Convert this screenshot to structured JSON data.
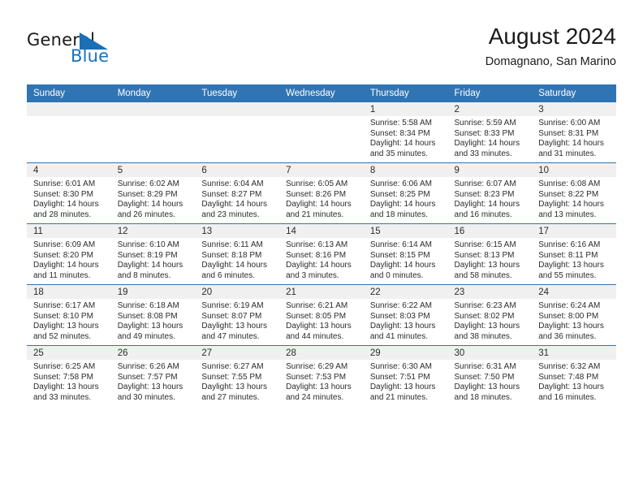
{
  "brand": {
    "name_part1": "General",
    "name_part2": "Blue",
    "accent_color": "#1673be",
    "header_color": "#3174b4"
  },
  "header": {
    "title": "August 2024",
    "location": "Domagnano, San Marino"
  },
  "calendar": {
    "weekday_headers": [
      "Sunday",
      "Monday",
      "Tuesday",
      "Wednesday",
      "Thursday",
      "Friday",
      "Saturday"
    ],
    "weeks": [
      [
        {
          "day": "",
          "blank": true,
          "sunrise": "",
          "sunset": "",
          "daylight_line1": "",
          "daylight_line2": ""
        },
        {
          "day": "",
          "blank": true,
          "sunrise": "",
          "sunset": "",
          "daylight_line1": "",
          "daylight_line2": ""
        },
        {
          "day": "",
          "blank": true,
          "sunrise": "",
          "sunset": "",
          "daylight_line1": "",
          "daylight_line2": ""
        },
        {
          "day": "",
          "blank": true,
          "sunrise": "",
          "sunset": "",
          "daylight_line1": "",
          "daylight_line2": ""
        },
        {
          "day": "1",
          "blank": false,
          "sunrise": "Sunrise: 5:58 AM",
          "sunset": "Sunset: 8:34 PM",
          "daylight_line1": "Daylight: 14 hours",
          "daylight_line2": "and 35 minutes."
        },
        {
          "day": "2",
          "blank": false,
          "sunrise": "Sunrise: 5:59 AM",
          "sunset": "Sunset: 8:33 PM",
          "daylight_line1": "Daylight: 14 hours",
          "daylight_line2": "and 33 minutes."
        },
        {
          "day": "3",
          "blank": false,
          "sunrise": "Sunrise: 6:00 AM",
          "sunset": "Sunset: 8:31 PM",
          "daylight_line1": "Daylight: 14 hours",
          "daylight_line2": "and 31 minutes."
        }
      ],
      [
        {
          "day": "4",
          "blank": false,
          "sunrise": "Sunrise: 6:01 AM",
          "sunset": "Sunset: 8:30 PM",
          "daylight_line1": "Daylight: 14 hours",
          "daylight_line2": "and 28 minutes."
        },
        {
          "day": "5",
          "blank": false,
          "sunrise": "Sunrise: 6:02 AM",
          "sunset": "Sunset: 8:29 PM",
          "daylight_line1": "Daylight: 14 hours",
          "daylight_line2": "and 26 minutes."
        },
        {
          "day": "6",
          "blank": false,
          "sunrise": "Sunrise: 6:04 AM",
          "sunset": "Sunset: 8:27 PM",
          "daylight_line1": "Daylight: 14 hours",
          "daylight_line2": "and 23 minutes."
        },
        {
          "day": "7",
          "blank": false,
          "sunrise": "Sunrise: 6:05 AM",
          "sunset": "Sunset: 8:26 PM",
          "daylight_line1": "Daylight: 14 hours",
          "daylight_line2": "and 21 minutes."
        },
        {
          "day": "8",
          "blank": false,
          "sunrise": "Sunrise: 6:06 AM",
          "sunset": "Sunset: 8:25 PM",
          "daylight_line1": "Daylight: 14 hours",
          "daylight_line2": "and 18 minutes."
        },
        {
          "day": "9",
          "blank": false,
          "sunrise": "Sunrise: 6:07 AM",
          "sunset": "Sunset: 8:23 PM",
          "daylight_line1": "Daylight: 14 hours",
          "daylight_line2": "and 16 minutes."
        },
        {
          "day": "10",
          "blank": false,
          "sunrise": "Sunrise: 6:08 AM",
          "sunset": "Sunset: 8:22 PM",
          "daylight_line1": "Daylight: 14 hours",
          "daylight_line2": "and 13 minutes."
        }
      ],
      [
        {
          "day": "11",
          "blank": false,
          "sunrise": "Sunrise: 6:09 AM",
          "sunset": "Sunset: 8:20 PM",
          "daylight_line1": "Daylight: 14 hours",
          "daylight_line2": "and 11 minutes."
        },
        {
          "day": "12",
          "blank": false,
          "sunrise": "Sunrise: 6:10 AM",
          "sunset": "Sunset: 8:19 PM",
          "daylight_line1": "Daylight: 14 hours",
          "daylight_line2": "and 8 minutes."
        },
        {
          "day": "13",
          "blank": false,
          "sunrise": "Sunrise: 6:11 AM",
          "sunset": "Sunset: 8:18 PM",
          "daylight_line1": "Daylight: 14 hours",
          "daylight_line2": "and 6 minutes."
        },
        {
          "day": "14",
          "blank": false,
          "sunrise": "Sunrise: 6:13 AM",
          "sunset": "Sunset: 8:16 PM",
          "daylight_line1": "Daylight: 14 hours",
          "daylight_line2": "and 3 minutes."
        },
        {
          "day": "15",
          "blank": false,
          "sunrise": "Sunrise: 6:14 AM",
          "sunset": "Sunset: 8:15 PM",
          "daylight_line1": "Daylight: 14 hours",
          "daylight_line2": "and 0 minutes."
        },
        {
          "day": "16",
          "blank": false,
          "sunrise": "Sunrise: 6:15 AM",
          "sunset": "Sunset: 8:13 PM",
          "daylight_line1": "Daylight: 13 hours",
          "daylight_line2": "and 58 minutes."
        },
        {
          "day": "17",
          "blank": false,
          "sunrise": "Sunrise: 6:16 AM",
          "sunset": "Sunset: 8:11 PM",
          "daylight_line1": "Daylight: 13 hours",
          "daylight_line2": "and 55 minutes."
        }
      ],
      [
        {
          "day": "18",
          "blank": false,
          "sunrise": "Sunrise: 6:17 AM",
          "sunset": "Sunset: 8:10 PM",
          "daylight_line1": "Daylight: 13 hours",
          "daylight_line2": "and 52 minutes."
        },
        {
          "day": "19",
          "blank": false,
          "sunrise": "Sunrise: 6:18 AM",
          "sunset": "Sunset: 8:08 PM",
          "daylight_line1": "Daylight: 13 hours",
          "daylight_line2": "and 49 minutes."
        },
        {
          "day": "20",
          "blank": false,
          "sunrise": "Sunrise: 6:19 AM",
          "sunset": "Sunset: 8:07 PM",
          "daylight_line1": "Daylight: 13 hours",
          "daylight_line2": "and 47 minutes."
        },
        {
          "day": "21",
          "blank": false,
          "sunrise": "Sunrise: 6:21 AM",
          "sunset": "Sunset: 8:05 PM",
          "daylight_line1": "Daylight: 13 hours",
          "daylight_line2": "and 44 minutes."
        },
        {
          "day": "22",
          "blank": false,
          "sunrise": "Sunrise: 6:22 AM",
          "sunset": "Sunset: 8:03 PM",
          "daylight_line1": "Daylight: 13 hours",
          "daylight_line2": "and 41 minutes."
        },
        {
          "day": "23",
          "blank": false,
          "sunrise": "Sunrise: 6:23 AM",
          "sunset": "Sunset: 8:02 PM",
          "daylight_line1": "Daylight: 13 hours",
          "daylight_line2": "and 38 minutes."
        },
        {
          "day": "24",
          "blank": false,
          "sunrise": "Sunrise: 6:24 AM",
          "sunset": "Sunset: 8:00 PM",
          "daylight_line1": "Daylight: 13 hours",
          "daylight_line2": "and 36 minutes."
        }
      ],
      [
        {
          "day": "25",
          "blank": false,
          "sunrise": "Sunrise: 6:25 AM",
          "sunset": "Sunset: 7:58 PM",
          "daylight_line1": "Daylight: 13 hours",
          "daylight_line2": "and 33 minutes."
        },
        {
          "day": "26",
          "blank": false,
          "sunrise": "Sunrise: 6:26 AM",
          "sunset": "Sunset: 7:57 PM",
          "daylight_line1": "Daylight: 13 hours",
          "daylight_line2": "and 30 minutes."
        },
        {
          "day": "27",
          "blank": false,
          "sunrise": "Sunrise: 6:27 AM",
          "sunset": "Sunset: 7:55 PM",
          "daylight_line1": "Daylight: 13 hours",
          "daylight_line2": "and 27 minutes."
        },
        {
          "day": "28",
          "blank": false,
          "sunrise": "Sunrise: 6:29 AM",
          "sunset": "Sunset: 7:53 PM",
          "daylight_line1": "Daylight: 13 hours",
          "daylight_line2": "and 24 minutes."
        },
        {
          "day": "29",
          "blank": false,
          "sunrise": "Sunrise: 6:30 AM",
          "sunset": "Sunset: 7:51 PM",
          "daylight_line1": "Daylight: 13 hours",
          "daylight_line2": "and 21 minutes."
        },
        {
          "day": "30",
          "blank": false,
          "sunrise": "Sunrise: 6:31 AM",
          "sunset": "Sunset: 7:50 PM",
          "daylight_line1": "Daylight: 13 hours",
          "daylight_line2": "and 18 minutes."
        },
        {
          "day": "31",
          "blank": false,
          "sunrise": "Sunrise: 6:32 AM",
          "sunset": "Sunset: 7:48 PM",
          "daylight_line1": "Daylight: 13 hours",
          "daylight_line2": "and 16 minutes."
        }
      ]
    ]
  }
}
